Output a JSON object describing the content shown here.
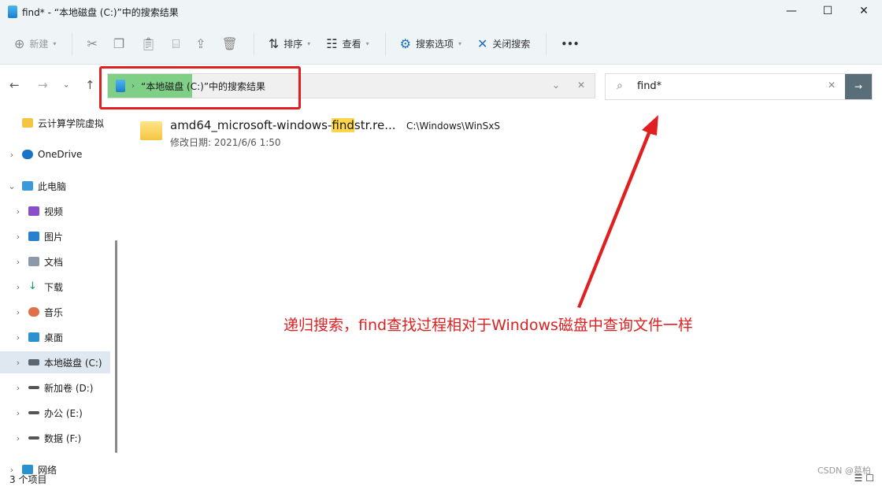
{
  "window": {
    "title": "find* - “本地磁盘 (C:)”中的搜索结果",
    "minimize": "—",
    "maximize": "☐",
    "close": "✕"
  },
  "toolbar": {
    "new": "新建",
    "sort": "排序",
    "view": "查看",
    "search_options": "搜索选项",
    "close_search": "关闭搜索",
    "more": "•••"
  },
  "address": {
    "breadcrumb": "“本地磁盘 (C:)”中的搜索结果"
  },
  "search": {
    "value": "find*"
  },
  "sidebar": {
    "items": [
      {
        "label": "云计算学院虚拟"
      },
      {
        "label": "OneDrive"
      },
      {
        "label": "此电脑"
      },
      {
        "label": "视频"
      },
      {
        "label": "图片"
      },
      {
        "label": "文档"
      },
      {
        "label": "下载"
      },
      {
        "label": "音乐"
      },
      {
        "label": "桌面"
      },
      {
        "label": "本地磁盘 (C:)"
      },
      {
        "label": "新加卷 (D:)"
      },
      {
        "label": "办公 (E:)"
      },
      {
        "label": "数据 (F:)"
      },
      {
        "label": "网络"
      }
    ]
  },
  "results": [
    {
      "name_pre": "amd64_microsoft-windows-",
      "name_hl": "find",
      "name_post": "str.re...",
      "path": "C:\\Windows\\WinSxS",
      "date": "修改日期: 2021/6/6 1:50"
    }
  ],
  "status": "3 个项目",
  "annotation": "递归搜索，find查找过程相对于Windows磁盘中查询文件一样",
  "watermark": "CSDN @葛柏",
  "colors": {
    "annotation": "#e02020",
    "highlight": "#7fcf87",
    "search_go": "#5a6e7a"
  }
}
